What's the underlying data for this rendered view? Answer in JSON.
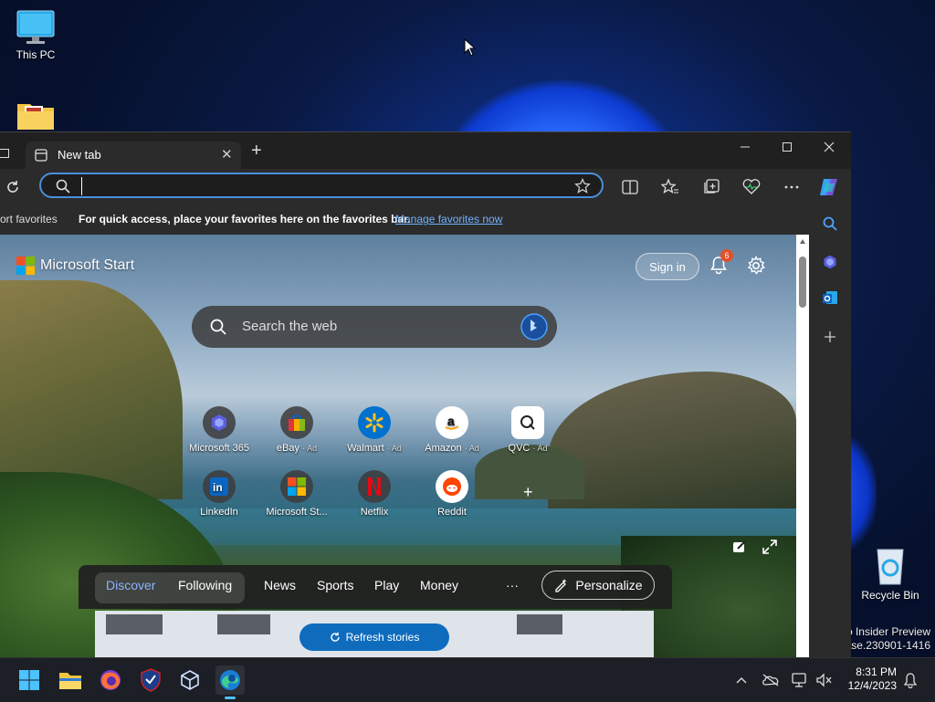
{
  "desktop": {
    "icons": [
      {
        "label": "This PC"
      },
      {
        "label": "Recycle Bin"
      }
    ],
    "watermark": {
      "line1": "o Insider Preview",
      "line2": "ease.230901-1416"
    }
  },
  "browser": {
    "tab": {
      "title": "New tab"
    },
    "address_bar": {
      "value": "",
      "placeholder": ""
    },
    "favorites_bar": {
      "import_label": "ort favorites",
      "message": "For quick access, place your favorites here on the favorites bar.",
      "manage_link": "Manage favorites now"
    },
    "colors": {
      "accent": "#4a8fdc",
      "link": "#6fb2ff",
      "refresh": "#0f6cbd",
      "notif": "#e0512a"
    }
  },
  "start_page": {
    "brand": "Microsoft Start",
    "sign_in": "Sign in",
    "notification_count": "6",
    "search_placeholder": "Search the web",
    "tiles": [
      {
        "label": "Microsoft 365",
        "sub": "",
        "icon": "m365-icon"
      },
      {
        "label": "eBay",
        "sub": "· Ad",
        "icon": "ebay-icon"
      },
      {
        "label": "Walmart",
        "sub": "· Ad",
        "icon": "walmart-icon"
      },
      {
        "label": "Amazon",
        "sub": "· Ad",
        "icon": "amazon-icon"
      },
      {
        "label": "QVC",
        "sub": "· Ad",
        "icon": "qvc-icon"
      },
      {
        "label": "LinkedIn",
        "sub": "",
        "icon": "linkedin-icon"
      },
      {
        "label": "Microsoft St...",
        "sub": "",
        "icon": "ms-store-icon"
      },
      {
        "label": "Netflix",
        "sub": "",
        "icon": "netflix-icon"
      },
      {
        "label": "Reddit",
        "sub": "",
        "icon": "reddit-icon"
      }
    ],
    "nav": {
      "discover": "Discover",
      "following": "Following",
      "news": "News",
      "sports": "Sports",
      "play": "Play",
      "money": "Money",
      "more": "···",
      "personalize": "Personalize"
    },
    "refresh_label": "Refresh stories"
  },
  "taskbar": {
    "time": "8:31 PM",
    "date": "12/4/2023"
  }
}
